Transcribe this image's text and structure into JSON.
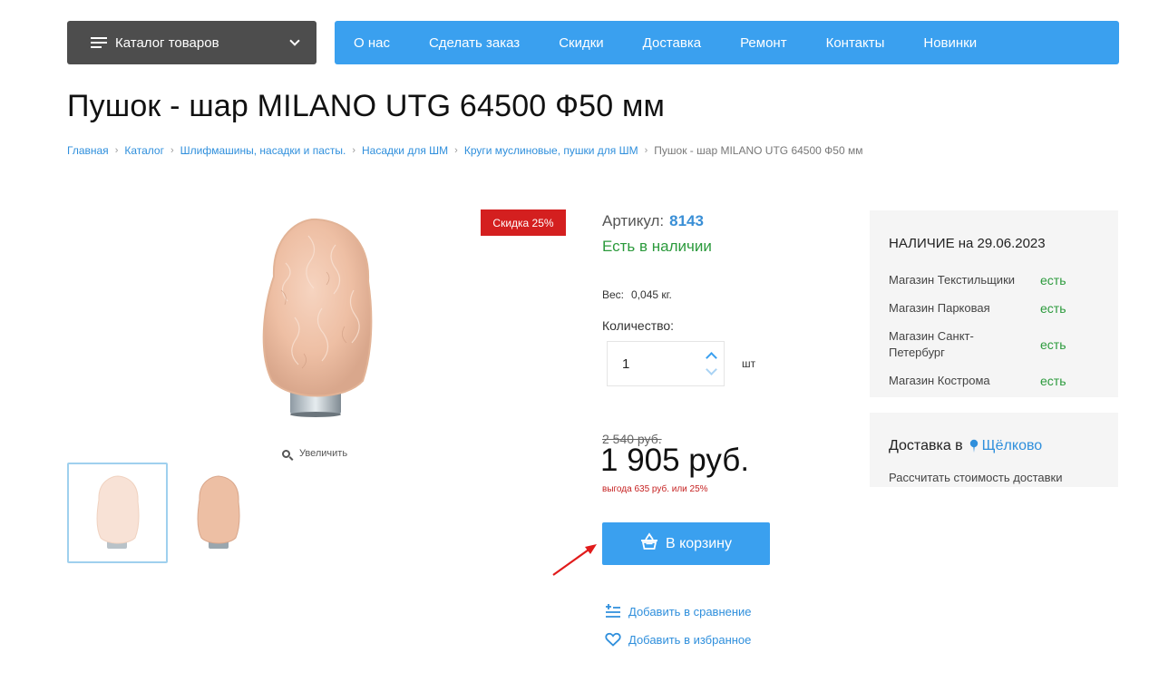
{
  "header": {
    "catalog_label": "Каталог товаров",
    "nav": [
      "О нас",
      "Сделать заказ",
      "Скидки",
      "Доставка",
      "Ремонт",
      "Контакты",
      "Новинки"
    ]
  },
  "product": {
    "title": "Пушок - шар MILANO UTG 64500 Ф50 мм",
    "sale_badge": "Скидка 25%",
    "zoom_label": "Увеличить",
    "sku_label": "Артикул:",
    "sku": "8143",
    "stock_status": "Есть в наличии",
    "weight_label": "Вес:",
    "weight_value": "0,045 кг.",
    "quantity_label": "Количество:",
    "quantity_value": "1",
    "unit": "шт",
    "old_price": "2 540 руб.",
    "price": "1 905 руб.",
    "saving": "выгода 635 руб. или 25%",
    "cart_button": "В корзину",
    "compare_label": "Добавить в сравнение",
    "favorite_label": "Добавить в избранное"
  },
  "breadcrumb": [
    "Главная",
    "Каталог",
    "Шлифмашины, насадки и пасты.",
    "Насадки для ШМ",
    "Круги муслиновые, пушки для ШМ",
    "Пушок - шар MILANO UTG 64500 Ф50 мм"
  ],
  "availability": {
    "title": "НАЛИЧИЕ на 29.06.2023",
    "stores": [
      {
        "name": "Магазин Текстильщики",
        "status": "есть"
      },
      {
        "name": "Магазин Парковая",
        "status": "есть"
      },
      {
        "name": "Магазин Санкт-Петербург",
        "status": "есть"
      },
      {
        "name": "Магазин Кострома",
        "status": "есть"
      }
    ]
  },
  "delivery": {
    "title": "Доставка в",
    "city": "Щёлково",
    "calc": "Рассчитать стоимость доставки"
  },
  "colors": {
    "accent": "#3aa0ef",
    "catalog_bg": "#4d4d4d",
    "sale": "#d41f1f",
    "in_stock": "#2b9a3c",
    "link": "#2f8fdc"
  }
}
